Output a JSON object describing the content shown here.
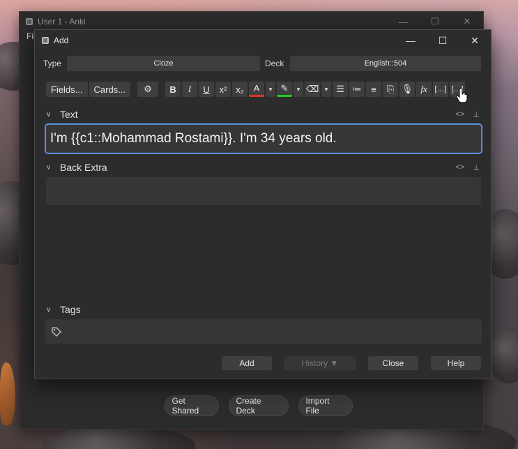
{
  "main_window": {
    "title": "User 1 - Anki",
    "menu_label": "Fil",
    "bottom_buttons": [
      "Get Shared",
      "Create Deck",
      "Import File"
    ]
  },
  "add_dialog": {
    "title": "Add",
    "type_label": "Type",
    "type_value": "Cloze",
    "deck_label": "Deck",
    "deck_value": "English::504",
    "toolbar": {
      "fields_label": "Fields...",
      "cards_label": "Cards..."
    },
    "fields": [
      {
        "name": "Text",
        "value": "I'm {{c1::Mohammad Rostami}}. I'm 34 years old."
      },
      {
        "name": "Back Extra",
        "value": ""
      }
    ],
    "tags_label": "Tags",
    "buttons": {
      "add": "Add",
      "history": "History ▼",
      "close": "Close",
      "help": "Help"
    }
  },
  "colors": {
    "focus_border": "#5a8dde",
    "text_color_bar": "#dd3333",
    "highlight_bar": "#22cc22"
  }
}
